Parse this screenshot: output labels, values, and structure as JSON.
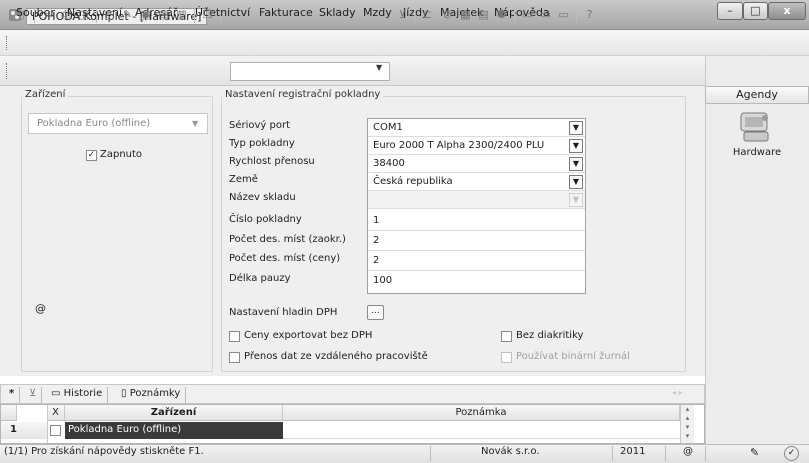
{
  "window": {
    "title": "POHODA Komplet - [Hardware]",
    "minimize": "–",
    "maximize": "□",
    "close": "x"
  },
  "menu": [
    "Soubor",
    "Nastavení",
    "Adresář",
    "Účetnictví",
    "Fakturace",
    "Sklady",
    "Mzdy",
    "Jízdy",
    "Majetek",
    "Nápověda"
  ],
  "toolbar": {
    "search_value": ""
  },
  "zarizeni": {
    "legend": "Zařízení",
    "device_select": "Pokladna Euro (offline)",
    "enabled_label": "Zapnuto",
    "enabled_checked": "✓",
    "at_symbol": "@"
  },
  "settings": {
    "legend": "Nastavení registrační pokladny",
    "fields": [
      {
        "label": "Sériový port",
        "value": "COM1",
        "dropdown": true
      },
      {
        "label": "Typ pokladny",
        "value": "Euro 2000 T Alpha 2300/2400 PLU",
        "dropdown": true
      },
      {
        "label": "Rychlost přenosu",
        "value": "38400",
        "dropdown": true
      },
      {
        "label": "Země",
        "value": "Česká republika",
        "dropdown": true
      },
      {
        "label": "Název skladu",
        "value": "",
        "dropdown": true
      },
      {
        "label": "Číslo pokladny",
        "value": "1",
        "dropdown": false
      },
      {
        "label": "Počet des. míst (zaokr.)",
        "value": "2",
        "dropdown": false
      },
      {
        "label": "Počet des. míst (ceny)",
        "value": "2",
        "dropdown": false
      },
      {
        "label": "Délka pauzy",
        "value": "100",
        "dropdown": false
      }
    ],
    "vat_label": "Nastavení hladin DPH",
    "vat_button": "...",
    "export_no_vat": "Ceny exportovat bez DPH",
    "remote_transfer": "Přenos dat ze vzdáleného pracoviště",
    "no_diacritics": "Bez diakritiky",
    "binary_journal": "Používat binární žurnál"
  },
  "agendy": {
    "header": "Agendy",
    "item": "Hardware"
  },
  "bottom_tabs": {
    "star": "*",
    "filter": "⊻",
    "historie": "Historie",
    "poznamky": "Poznámky"
  },
  "table": {
    "headers": {
      "x": "X",
      "zarizeni": "Zařízení",
      "poznamka": "Poznámka"
    },
    "rows": [
      {
        "num": "1",
        "zarizeni": "Pokladna Euro (offline)",
        "poznamka": ""
      }
    ]
  },
  "status": {
    "help": "(1/1) Pro získání nápovědy stiskněte F1.",
    "company": "Novák s.r.o.",
    "year": "2011",
    "at": "@"
  }
}
